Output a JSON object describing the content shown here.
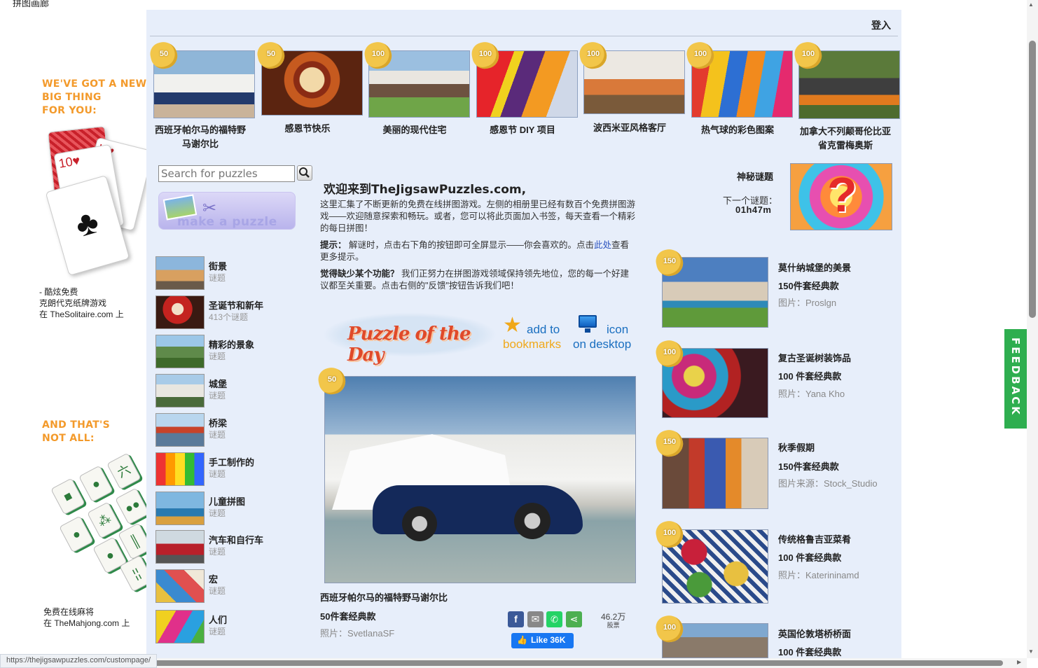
{
  "tab_title": "拼图画廊",
  "header": {
    "login": "登入"
  },
  "left_ads": {
    "heading1": [
      "WE'VE GOT A NEW",
      "BIG THING",
      "FOR YOU:"
    ],
    "solitaire_text": [
      "- 酷炫免费",
      "克朗代克纸牌游戏",
      "在 TheSolitaire.com 上"
    ],
    "heading2": [
      "AND THAT'S",
      "NOT ALL:"
    ],
    "mahjong_text": [
      "免费在线麻将",
      "在 TheMahjong.com 上"
    ]
  },
  "top_puzzles": [
    {
      "pieces": "50",
      "title_lines": [
        "西班牙帕尔马的福特野",
        "马谢尔比"
      ]
    },
    {
      "pieces": "50",
      "title_lines": [
        "感恩节快乐"
      ]
    },
    {
      "pieces": "100",
      "title_lines": [
        "美丽的现代住宅"
      ]
    },
    {
      "pieces": "100",
      "title_lines": [
        "感恩节 DIY 项目"
      ]
    },
    {
      "pieces": "100",
      "title_lines": [
        "波西米亚风格客厅"
      ]
    },
    {
      "pieces": "100",
      "title_lines": [
        "热气球的彩色图案"
      ]
    },
    {
      "pieces": "100",
      "title_lines": [
        "加拿大不列颠哥伦比亚",
        "省克雷梅奥斯"
      ]
    }
  ],
  "search": {
    "placeholder": "Search for puzzles"
  },
  "make_puzzle": {
    "label": "make a puzzle"
  },
  "categories": [
    {
      "name": "街景",
      "sub": "谜题"
    },
    {
      "name": "圣诞节和新年",
      "sub": "413个谜题"
    },
    {
      "name": "精彩的景象",
      "sub": "谜题"
    },
    {
      "name": "城堡",
      "sub": "谜题"
    },
    {
      "name": "桥梁",
      "sub": "谜题"
    },
    {
      "name": "手工制作的",
      "sub": "谜题"
    },
    {
      "name": "儿童拼图",
      "sub": "谜题"
    },
    {
      "name": "汽车和自行车",
      "sub": "谜题"
    },
    {
      "name": "宏",
      "sub": "谜题"
    },
    {
      "name": "人们",
      "sub": "谜题"
    }
  ],
  "welcome": {
    "title": "欢迎来到TheJigsawPuzzles.com,",
    "intro": "这里汇集了不断更新的免费在线拼图游戏。左侧的相册里已经有数百个免费拼图游戏——欢迎随意探索和畅玩。或者，您可以将此页面加入书签，每天查看一个精彩的每日拼图！",
    "tip_label": "提示：",
    "tip_text": " 解谜时，点击右下角的按钮即可全屏显示——你会喜欢的。点击",
    "tip_link": "此处",
    "tip_end": "查看更多提示。",
    "missing_label": "觉得缺少某个功能？",
    "missing_text": " 我们正努力在拼图游戏领域保持领先地位，您的每一个好建议都至关重要。点击右侧的\"反馈\"按钮告诉我们吧！"
  },
  "potd": {
    "label": "Puzzle of the Day"
  },
  "bookmarks": {
    "line1": "add to",
    "line2": "bookmarks"
  },
  "desktop": {
    "line1": "icon",
    "line2": "on desktop"
  },
  "hero": {
    "pieces": "50",
    "title": "西班牙帕尔马的福特野马谢尔比",
    "pieces_text": "50件套经典款",
    "credit": "照片：SvetlanaSF",
    "votes": "46.2万",
    "votes_label": "股票",
    "like": "Like 36K"
  },
  "mystery": {
    "label": "神秘谜题",
    "next": "下一个谜题：",
    "time": "01h47m"
  },
  "right_puzzles": [
    {
      "pieces": "150",
      "title": "莫什纳城堡的美景",
      "pieces_text": "150件套经典款",
      "credit": "图片：Proslgn"
    },
    {
      "pieces": "100",
      "title": "复古圣诞树装饰品",
      "pieces_text": "100 件套经典款",
      "credit": "照片：Yana Kho"
    },
    {
      "pieces": "150",
      "title": "秋季假期",
      "pieces_text": "150件套经典款",
      "credit": "图片来源：Stock_Studio"
    },
    {
      "pieces": "100",
      "title": "传统格鲁吉亚菜肴",
      "pieces_text": "100 件套经典款",
      "credit": "照片：Katerininamd"
    },
    {
      "pieces": "100",
      "title": "英国伦敦塔桥桥面",
      "pieces_text": "100 件套经典款",
      "credit": ""
    }
  ],
  "feedback": {
    "label": "FEEDBACK"
  },
  "status_url": "https://thejigsawpuzzles.com/custompage/",
  "colors": {
    "panel": "#e7eefa",
    "accent_orange": "#f39a2b",
    "feedback_green": "#2eae4f",
    "link_blue": "#2a52be"
  }
}
